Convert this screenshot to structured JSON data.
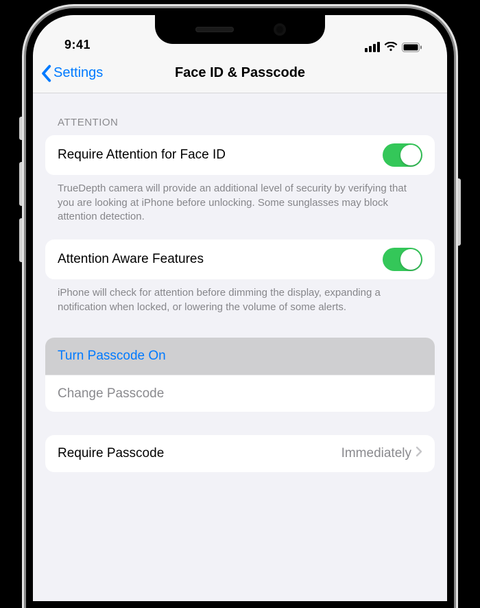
{
  "status": {
    "time": "9:41"
  },
  "nav": {
    "back_label": "Settings",
    "title": "Face ID & Passcode"
  },
  "attention": {
    "header": "ATTENTION",
    "require": {
      "label": "Require Attention for Face ID",
      "on": true,
      "footer": "TrueDepth camera will provide an additional level of security by verifying that you are looking at iPhone before unlocking. Some sunglasses may block attention detection."
    },
    "aware": {
      "label": "Attention Aware Features",
      "on": true,
      "footer": "iPhone will check for attention before dimming the display, expanding a notification when locked, or lowering the volume of some alerts."
    }
  },
  "passcode": {
    "turn_on": "Turn Passcode On",
    "change": "Change Passcode",
    "require_label": "Require Passcode",
    "require_value": "Immediately"
  }
}
